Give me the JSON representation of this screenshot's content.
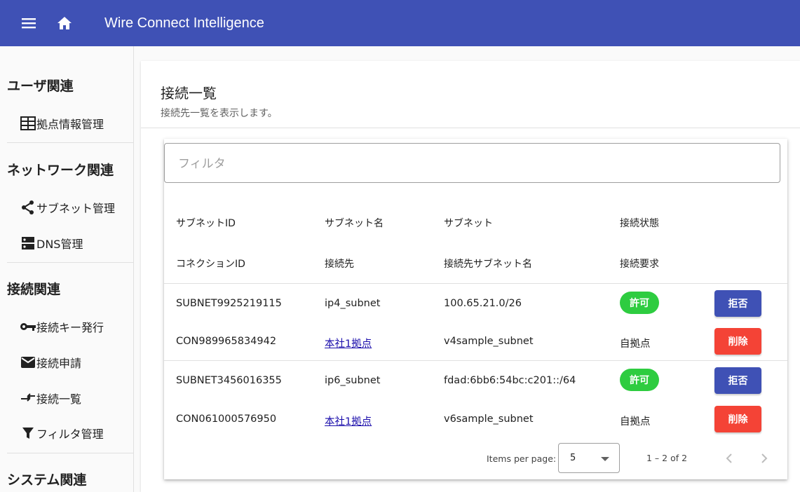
{
  "app": {
    "title": "Wire Connect Intelligence"
  },
  "toolbar": {
    "menu_icon": "menu-icon",
    "home_icon": "home-icon"
  },
  "sidebar": {
    "sections": [
      {
        "label": "ユーザ関連"
      },
      {
        "label": "ネットワーク関連"
      },
      {
        "label": "接続関連"
      },
      {
        "label": "システム関連"
      }
    ],
    "items": [
      {
        "label": "拠点情報管理",
        "icon": "table-icon"
      },
      {
        "label": "サブネット管理",
        "icon": "share-icon"
      },
      {
        "label": "DNS管理",
        "icon": "dns-icon"
      },
      {
        "label": "接続キー発行",
        "icon": "key-icon"
      },
      {
        "label": "接続申請",
        "icon": "mail-icon"
      },
      {
        "label": "接続一覧",
        "icon": "compare-arrows-icon"
      },
      {
        "label": "フィルタ管理",
        "icon": "filter-icon"
      }
    ]
  },
  "page": {
    "title": "接続一覧",
    "subtitle": "接続先一覧を表示します。"
  },
  "filter": {
    "placeholder": "フィルタ"
  },
  "table": {
    "headers_row1": [
      "サブネットID",
      "サブネット名",
      "サブネット",
      "接続状態"
    ],
    "headers_row2": [
      "コネクションID",
      "接続先",
      "接続先サブネット名",
      "接続要求"
    ],
    "rows": [
      {
        "subnet_id": "SUBNET9925219115",
        "subnet_name": "ip4_subnet",
        "subnet": "100.65.21.0/26",
        "status": "許可",
        "action1": "拒否",
        "connection_id": "CON989965834942",
        "destination": "本社1拠点",
        "dest_subnet_name": "v4sample_subnet",
        "request": "自拠点",
        "action2": "削除"
      },
      {
        "subnet_id": "SUBNET3456016355",
        "subnet_name": "ip6_subnet",
        "subnet": "fdad:6bb6:54bc:c201::/64",
        "status": "許可",
        "action1": "拒否",
        "connection_id": "CON061000576950",
        "destination": "本社1拠点",
        "dest_subnet_name": "v6sample_subnet",
        "request": "自拠点",
        "action2": "削除"
      }
    ]
  },
  "paginator": {
    "items_per_page_label": "Items per page:",
    "page_size": "5",
    "range_label": "1 – 2 of 2",
    "prev_icon": "chevron-left-icon",
    "next_icon": "chevron-right-icon"
  },
  "colors": {
    "primary": "#3f51b5",
    "status_chip": "#2ecc40",
    "danger": "#f44336"
  }
}
